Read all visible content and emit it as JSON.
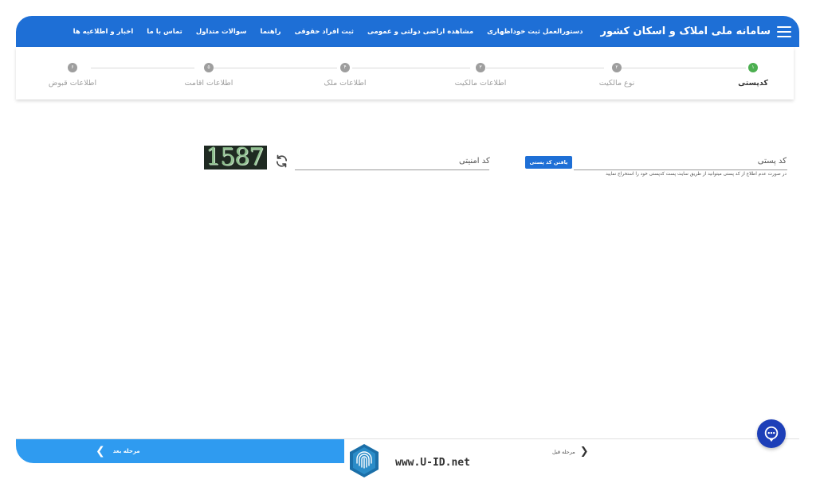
{
  "header": {
    "title": "سامانه ملی املاک و اسکان کشور",
    "nav": [
      "اخبار و اطلاعیه ها",
      "تماس با ما",
      "سوالات متداول",
      "راهنما",
      "ثبت افراد حقوقی",
      "مشاهده اراضی دولتی و عمومی",
      "دستورالعمل ثبت خوداظهاری"
    ]
  },
  "steps": [
    {
      "num": "۱",
      "label": "کدپستی",
      "active": true
    },
    {
      "num": "۲",
      "label": "نوع مالکیت",
      "active": false
    },
    {
      "num": "۳",
      "label": "اطلاعات مالکیت",
      "active": false
    },
    {
      "num": "۴",
      "label": "اطلاعات ملک",
      "active": false
    },
    {
      "num": "۵",
      "label": "اطلاعات اقامت",
      "active": false
    },
    {
      "num": "۶",
      "label": "اطلاعات قبوض",
      "active": false
    }
  ],
  "form": {
    "postal_label": "کد پستی",
    "postal_value": "",
    "find_button": "یافتن کد پستی",
    "postal_hint": "در صورت عدم اطلاع از کد پستی میتوانید از طریق سایت پست کدپستی خود را استخراج نمایید",
    "captcha_label": "کد امنیتی",
    "captcha_value": "",
    "captcha_text": "1587"
  },
  "footer": {
    "next_label": "مرحله بعد",
    "prev_label": "مرحله قبل",
    "watermark": "www.U-ID.net"
  },
  "colors": {
    "primary": "#1e6fd6",
    "next_bar": "#2f9bf0",
    "active_step": "#4caf50",
    "inactive_step": "#9e9e9e",
    "chat": "#1d3fb8"
  }
}
